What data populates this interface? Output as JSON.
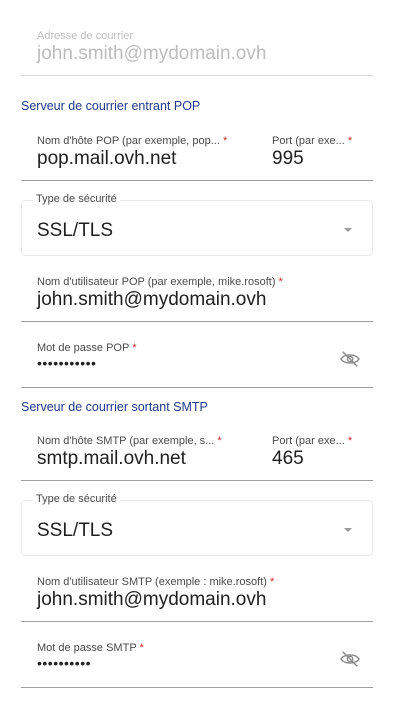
{
  "email": {
    "label": "Adresse de courrier",
    "value": "john.smith@mydomain.ovh"
  },
  "pop": {
    "section_title": "Serveur de courrier entrant POP",
    "host_label": "Nom d'hôte POP (par exemple, pop...",
    "host_value": "pop.mail.ovh.net",
    "port_label": "Port (par exe...",
    "port_value": "995",
    "security_label": "Type de sécurité",
    "security_value": "SSL/TLS",
    "username_label": "Nom d'utilisateur POP (par exemple, mike.rosoft)",
    "username_value": "john.smith@mydomain.ovh",
    "password_label": "Mot de passe POP",
    "password_value": "•••••••••••"
  },
  "smtp": {
    "section_title": "Serveur de courrier sortant SMTP",
    "host_label": "Nom d'hôte SMTP (par exemple, s...",
    "host_value": "smtp.mail.ovh.net",
    "port_label": "Port (par exe...",
    "port_value": "465",
    "security_label": "Type de sécurité",
    "security_value": "SSL/TLS",
    "username_label": "Nom d'utilisateur SMTP (exemple : mike.rosoft)",
    "username_value": "john.smith@mydomain.ovh",
    "password_label": "Mot de passe SMTP",
    "password_value": "••••••••••"
  },
  "required_marker": "*",
  "colors": {
    "section_title": "#1e3a8a",
    "required": "#c62828",
    "disabled_text": "#bdbdbd"
  },
  "icons": {
    "password_visibility": "eye-off-icon",
    "dropdown": "caret-down-icon"
  }
}
